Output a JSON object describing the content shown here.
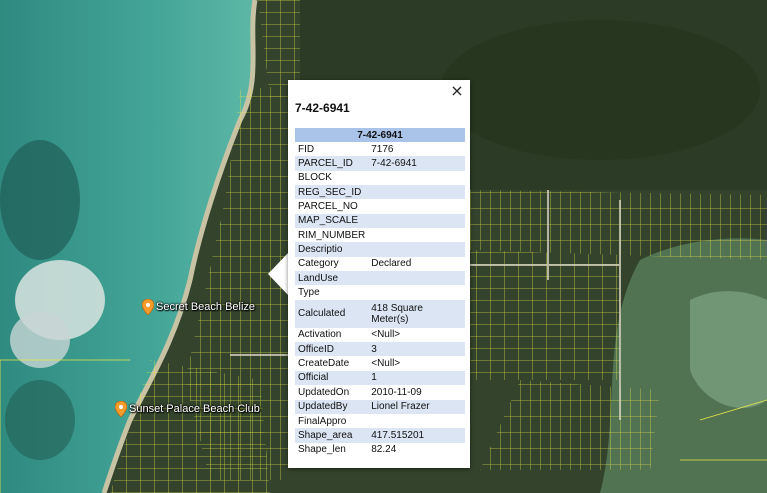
{
  "map": {
    "markers": [
      {
        "label": "Secret Beach Belize",
        "icon": "map-pin-icon"
      },
      {
        "label": "Sunset Palace Beach Club",
        "icon": "map-pin-icon"
      }
    ]
  },
  "popup": {
    "close_icon": "×",
    "title": "7-42-6941",
    "table_header": "7-42-6941",
    "rows": [
      {
        "key": "FID",
        "value": "7176"
      },
      {
        "key": "PARCEL_ID",
        "value": "7-42-6941"
      },
      {
        "key": "BLOCK",
        "value": ""
      },
      {
        "key": "REG_SEC_ID",
        "value": ""
      },
      {
        "key": "PARCEL_NO",
        "value": ""
      },
      {
        "key": "MAP_SCALE",
        "value": ""
      },
      {
        "key": "RIM_NUMBER",
        "value": ""
      },
      {
        "key": "Descriptio",
        "value": ""
      },
      {
        "key": "Category",
        "value": "Declared"
      },
      {
        "key": "LandUse",
        "value": ""
      },
      {
        "key": "Type",
        "value": ""
      },
      {
        "key": "Calculated",
        "value": "418 Square Meter(s)"
      },
      {
        "key": "Activation",
        "value": "<Null>"
      },
      {
        "key": "OfficeID",
        "value": "3"
      },
      {
        "key": "CreateDate",
        "value": "<Null>"
      },
      {
        "key": "Official",
        "value": "1"
      },
      {
        "key": "UpdatedOn",
        "value": "2010-11-09"
      },
      {
        "key": "UpdatedBy",
        "value": "Lionel Frazer"
      },
      {
        "key": "FinalAppro",
        "value": ""
      },
      {
        "key": "Shape_area",
        "value": "417.515201"
      },
      {
        "key": "Shape_len",
        "value": "82.24"
      }
    ]
  },
  "colors": {
    "parcel_lines": "#e8e84a",
    "sea": "#3f9a8c",
    "land": "#3b4a30",
    "table_header_bg": "#a9c4e8",
    "table_alt_bg": "#dbe5f3",
    "marker": "#f39c2c"
  }
}
